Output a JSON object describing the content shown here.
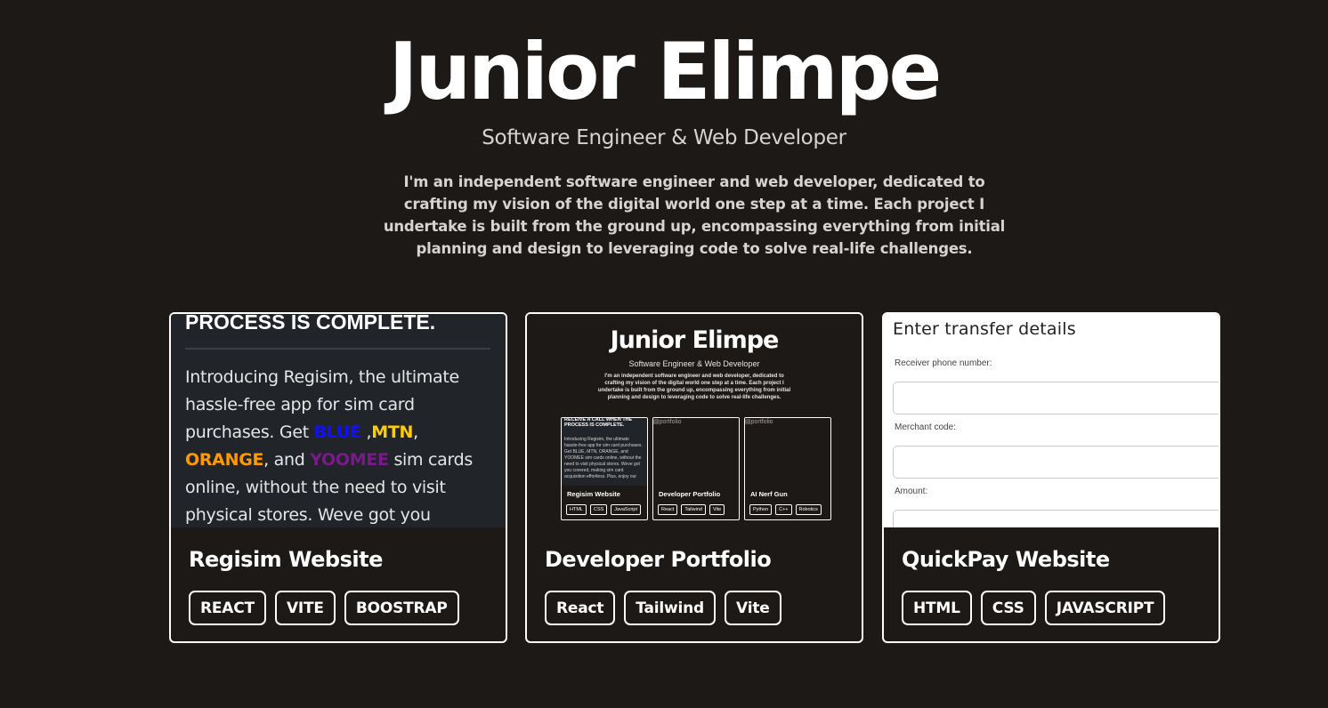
{
  "header": {
    "name": "Junior Elimpe",
    "role": "Software Engineer & Web Developer",
    "bio": "I'm an independent software engineer and web developer, dedicated to crafting my vision of the digital world one step at a time. Each project I undertake is built from the ground up, encompassing everything from initial planning and design to leveraging code to solve real-life challenges."
  },
  "projects": [
    {
      "title": "Regisim Website",
      "tags": [
        "REACT",
        "VITE",
        "BOOSTRAP"
      ],
      "preview": {
        "heading": "PROCESS IS COMPLETE.",
        "text_parts": [
          "Introducing Regisim, the ultimate hassle-free app for sim card purchases. Get ",
          "BLUE",
          " ,",
          "MTN",
          ", ",
          "ORANGE",
          ", and ",
          "YOOMEE",
          " sim cards online, without the need to visit physical stores. Weve got you covered, making sim card"
        ]
      }
    },
    {
      "title": "Developer Portfolio",
      "tags": [
        "React",
        "Tailwind",
        "Vite"
      ],
      "preview": {
        "name": "Junior Elimpe",
        "role": "Software Engineer & Web Developer",
        "bio": "I'm an independent software engineer and web developer, dedicated to crafting my vision of the digital world one step at a time. Each project I undertake is built from the ground up, encompassing everything from initial planning and design to leveraging code to solve real-life challenges.",
        "cards": [
          {
            "title": "Regisim Website",
            "tags": [
              "HTML",
              "CSS",
              "JavaScript"
            ],
            "shot_heading": "RECEIVE A CALL WHEN THE PROCESS IS COMPLETE.",
            "shot_body": "Introducing Regisim, the ultimate hassle-free app for sim card purchases. Get BLUE, MTN, ORANGE, and YOOMEE sim cards online, without the need to visit physical stores. Weve got you covered, making sim card acquisition effortless. Plus, enjoy our"
          },
          {
            "title": "Developer Portfolio",
            "tags": [
              "React",
              "Tailwind",
              "Vite"
            ],
            "alt": "portfolio"
          },
          {
            "title": "AI Nerf Gun",
            "tags": [
              "Python",
              "C++",
              "Robotics"
            ],
            "alt": "portfolio"
          }
        ]
      }
    },
    {
      "title": "QuickPay Website",
      "tags": [
        "HTML",
        "CSS",
        "JAVASCRIPT"
      ],
      "preview": {
        "heading": "Enter transfer details",
        "fields": [
          "Receiver phone number:",
          "Merchant code:",
          "Amount:"
        ]
      }
    }
  ],
  "colors": {
    "background": "#1c1917",
    "text": "#ffffff",
    "muted": "#d6d3d1",
    "blue": "#1010ff",
    "mtn": "#ffcc00",
    "orange": "#ff9900",
    "yoomee": "#7a1a8a"
  }
}
